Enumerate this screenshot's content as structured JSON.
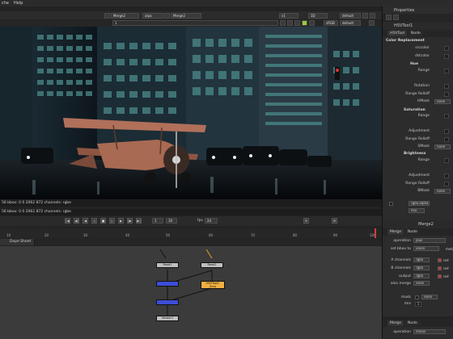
{
  "menubar": {
    "items": [
      "che",
      "Help"
    ]
  },
  "viewer_toolbar": {
    "merge_a": "Merge2",
    "alpha": "alpa",
    "merge_b": "Merge2",
    "zoom": "v1",
    "mode": "3D",
    "lut": "default",
    "srgb": "sRGB",
    "frame_range": "1"
  },
  "viewer_info": {
    "line1": "56 bbox: 0 0 2062 872 channels: rgbe",
    "line2": "56 bbox: 0 0 2062 872 channels: rgbe"
  },
  "transport": {
    "frame_label": "fps",
    "frame_value": "24",
    "incr": "1",
    "frame": "10"
  },
  "timeline": {
    "ticks": [
      "10",
      "20",
      "30",
      "40",
      "50",
      "60",
      "70",
      "80",
      "90",
      "100"
    ]
  },
  "node_tabs": {
    "tab1": "Dope Sheet"
  },
  "nodes": {
    "read1": "Read1",
    "read2": "Read2",
    "hsvtool": "HSVTool1\n(hsv)",
    "merge1": "",
    "merge2": "",
    "viewer": "Viewer1"
  },
  "properties": {
    "title": "Properties",
    "hsv_title": "HSVTool1",
    "tab_hsv": "HSVTool",
    "tab_node": "Node",
    "color_replacement": "Color Replacement",
    "src_color": "srccolor",
    "dst_color": "dstcolor",
    "hue_label": "Hue",
    "range": "Range",
    "rotation": "Rotation",
    "range_rolloff": "Range Rolloff",
    "h_mask": "HMask",
    "saturation": "Saturation",
    "adjustment": "Adjustment",
    "s_mask": "SMask",
    "brightness": "Brightness",
    "b_mask": "BMask",
    "none": "none",
    "mask_channel": "rgba.alpha",
    "mix_label": "mix",
    "merge_title": "Merge2",
    "merge_tab": "Merge",
    "node_tab": "Node",
    "operation_label": "operation",
    "operation": "plus",
    "set_bbox_label": "set bbox to",
    "set_bbox": "union",
    "metadata": "meta",
    "a_channels": "A channels",
    "b_channels": "B channels",
    "output": "output",
    "also_merge": "also merge",
    "rgba": "rgba",
    "red": "red",
    "mask_label": "mask",
    "mix_value": "1",
    "merge3_title": "Merge3",
    "operation2": "minus"
  }
}
